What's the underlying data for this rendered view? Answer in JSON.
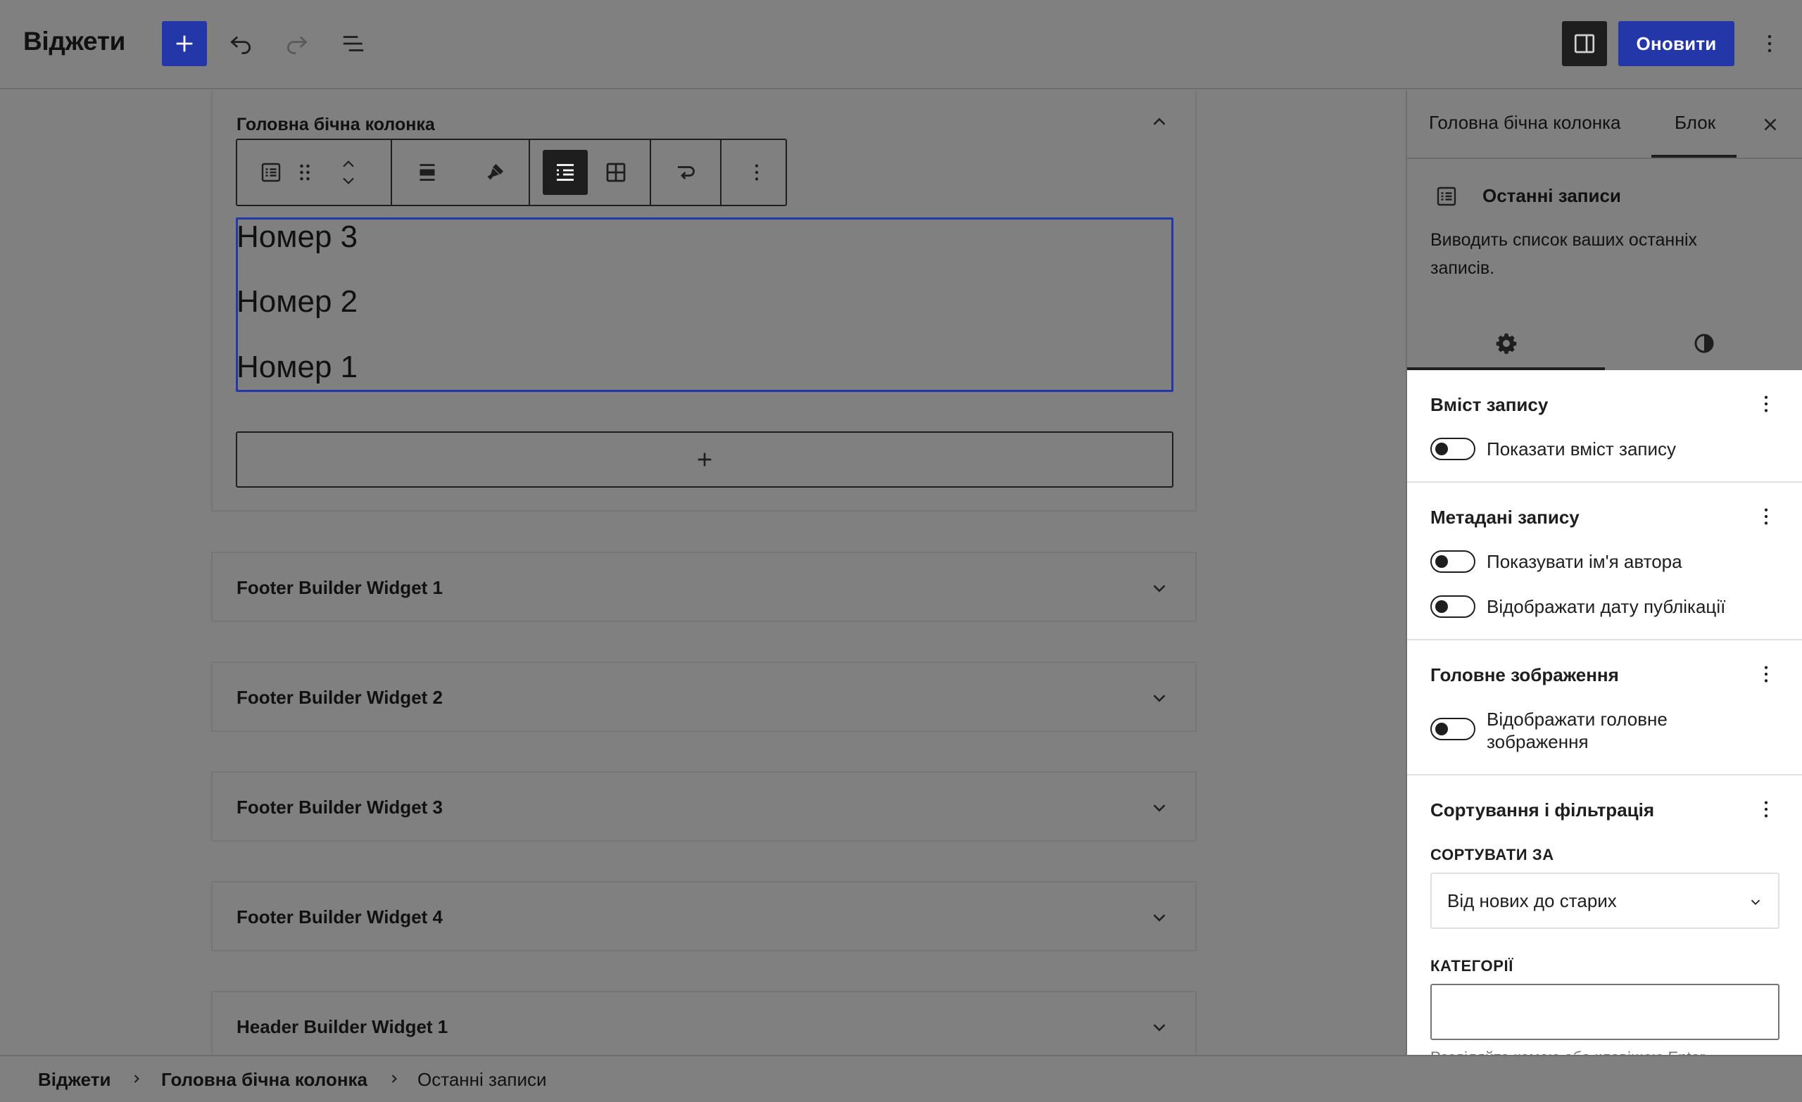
{
  "header": {
    "title": "Віджети",
    "update_label": "Оновити"
  },
  "main_area": {
    "title": "Головна бічна колонка",
    "posts": [
      "Номер 3",
      "Номер 2",
      "Номер 1"
    ]
  },
  "widget_areas": [
    {
      "title": "Footer Builder Widget 1"
    },
    {
      "title": "Footer Builder Widget 2"
    },
    {
      "title": "Footer Builder Widget 3"
    },
    {
      "title": "Footer Builder Widget 4"
    },
    {
      "title": "Header Builder Widget 1"
    }
  ],
  "sidebar": {
    "tabs": [
      {
        "label": "Головна бічна колонка"
      },
      {
        "label": "Блок"
      }
    ],
    "active_tab": "Блок",
    "block_card": {
      "title": "Останні записи",
      "description": "Виводить список ваших останніх записів."
    },
    "panels": {
      "content": {
        "title": "Вміст запису",
        "toggles": [
          {
            "label": "Показати вміст запису",
            "checked": false
          }
        ]
      },
      "meta": {
        "title": "Метадані запису",
        "toggles": [
          {
            "label": "Показувати ім'я автора",
            "checked": false
          },
          {
            "label": "Відображати дату публікації",
            "checked": false
          }
        ]
      },
      "featured": {
        "title": "Головне зображення",
        "toggles": [
          {
            "label": "Відображати головне зображення",
            "checked": false
          }
        ]
      },
      "sorting": {
        "title": "Сортування і фільтрація",
        "order_label": "СОРТУВАТИ ЗА",
        "order_value": "Від нових до старих",
        "categories_label": "КАТЕГОРІЇ",
        "categories_value": "",
        "help": "Розділяйте комою або клавішею Enter."
      }
    }
  },
  "breadcrumb": [
    "Віджети",
    "Головна бічна колонка",
    "Останні записи"
  ],
  "colors": {
    "accent": "#2337a8",
    "overlay": "#808080",
    "dark": "#1e1e1e",
    "panel": "#ffffff"
  }
}
